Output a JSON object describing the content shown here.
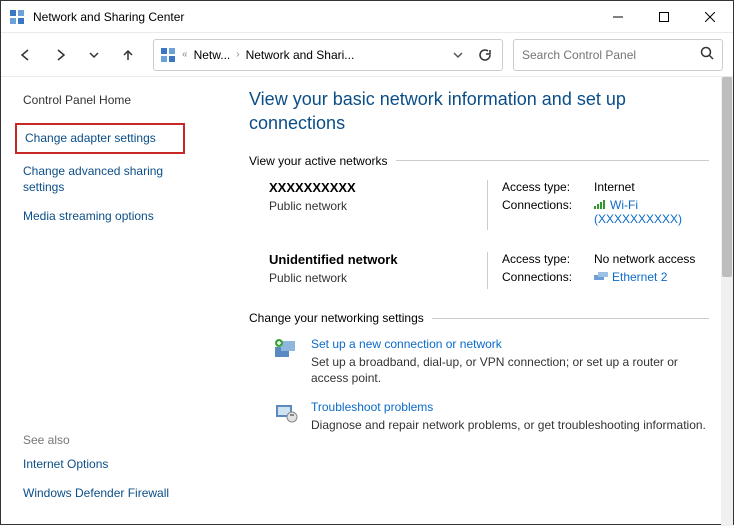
{
  "window": {
    "title": "Network and Sharing Center"
  },
  "breadcrumb": {
    "item1": "Netw...",
    "item2": "Network and Shari..."
  },
  "search": {
    "placeholder": "Search Control Panel"
  },
  "sidebar": {
    "home": "Control Panel Home",
    "adapter": "Change adapter settings",
    "advanced": "Change advanced sharing settings",
    "media": "Media streaming options",
    "seealso_title": "See also",
    "internet_options": "Internet Options",
    "defender": "Windows Defender Firewall"
  },
  "main": {
    "heading": "View your basic network information and set up connections",
    "active_label": "View your active networks",
    "change_label": "Change your networking settings",
    "networks": [
      {
        "name": "XXXXXXXXXX",
        "type": "Public network",
        "access_k": "Access type:",
        "access_v": "Internet",
        "conn_k": "Connections:",
        "conn_v": "Wi-Fi (XXXXXXXXXX)"
      },
      {
        "name": "Unidentified network",
        "type": "Public network",
        "access_k": "Access type:",
        "access_v": "No network access",
        "conn_k": "Connections:",
        "conn_v": "Ethernet 2"
      }
    ],
    "setup": {
      "title": "Set up a new connection or network",
      "desc": "Set up a broadband, dial-up, or VPN connection; or set up a router or access point."
    },
    "troubleshoot": {
      "title": "Troubleshoot problems",
      "desc": "Diagnose and repair network problems, or get troubleshooting information."
    }
  }
}
